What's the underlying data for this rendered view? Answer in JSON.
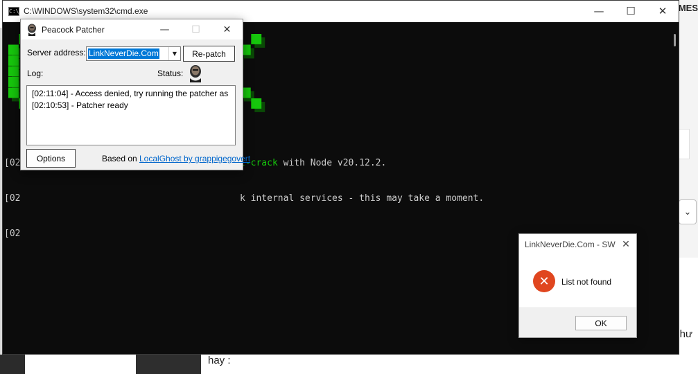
{
  "background": {
    "right_fragment": "MES",
    "right_word": "hư",
    "bottom_word": "hay :",
    "dropdown_glyph": "⌄"
  },
  "cmd": {
    "title": "C:\\WINDOWS\\system32\\cmd.exe",
    "icon_label": "C:\\",
    "minimize": "—",
    "maximize": "☐",
    "close": "✕",
    "banner_text": "PEACOCK",
    "banner_color": "#16c60c",
    "left_lines": [
      "[02",
      "[02",
      "[02"
    ],
    "line1_green": "l-crack",
    "line1_rest": " with Node v20.12.2.",
    "line2": "k internal services - this may take a moment."
  },
  "patcher": {
    "title": "Peacock Patcher",
    "minimize": "—",
    "maximize": "☐",
    "close": "✕",
    "server_label": "Server address:",
    "server_value": "LinkNeverDie.Com",
    "repatch_button": "Re-patch",
    "log_label": "Log:",
    "status_label": "Status:",
    "log": [
      "[02:11:04] - Access denied, try running the patcher as a...",
      "[02:10:53] - Patcher ready"
    ],
    "options_button": "Options",
    "based_on": "Based on",
    "based_link": "LocalGhost by grappigegovert"
  },
  "error_dialog": {
    "title": "LinkNeverDie.Com - SW",
    "close": "✕",
    "icon": "✕",
    "message": "List not found",
    "ok_button": "OK",
    "icon_color": "#e0461f"
  }
}
